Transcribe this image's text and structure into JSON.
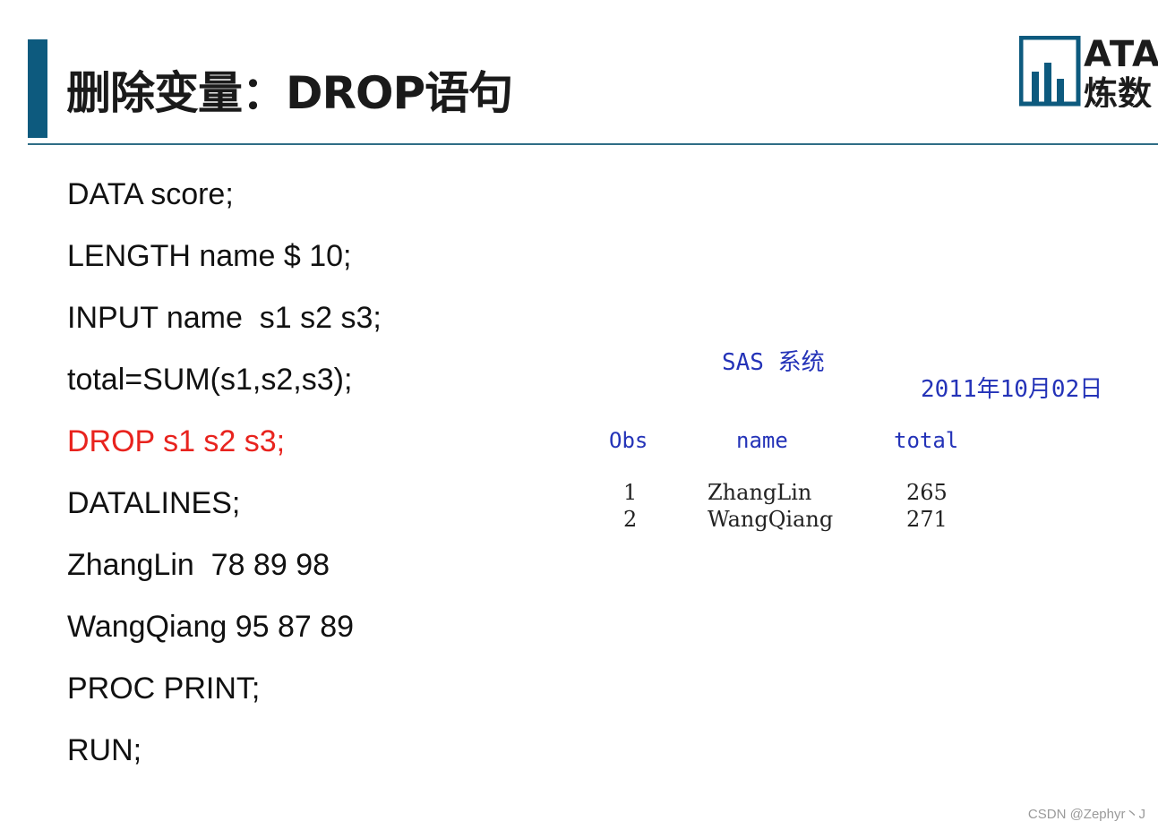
{
  "slide": {
    "title": "删除变量：DROP语句",
    "logo": {
      "top_text": "ATA",
      "bottom_text": "炼数"
    },
    "accent_color": "#0d5a7e",
    "highlight_color": "#e8231e"
  },
  "code_lines": [
    "DATA score;",
    "LENGTH name $ 10;",
    "INPUT name  s1 s2 s3;",
    "total=SUM(s1,s2,s3);",
    "DROP s1 s2 s3;",
    "DATALINES;",
    "ZhangLin  78 89 98",
    "WangQiang 95 87 89",
    "PROC PRINT;",
    "RUN;"
  ],
  "output": {
    "title": "SAS 系统",
    "date": "2011年10月02日",
    "headers": [
      "Obs",
      "name",
      "total"
    ],
    "rows": [
      [
        "1",
        "ZhangLin",
        "265"
      ],
      [
        "2",
        "WangQiang",
        "271"
      ]
    ],
    "text_color": "#2433b8"
  },
  "watermark": "CSDN @Zephyr丶J"
}
